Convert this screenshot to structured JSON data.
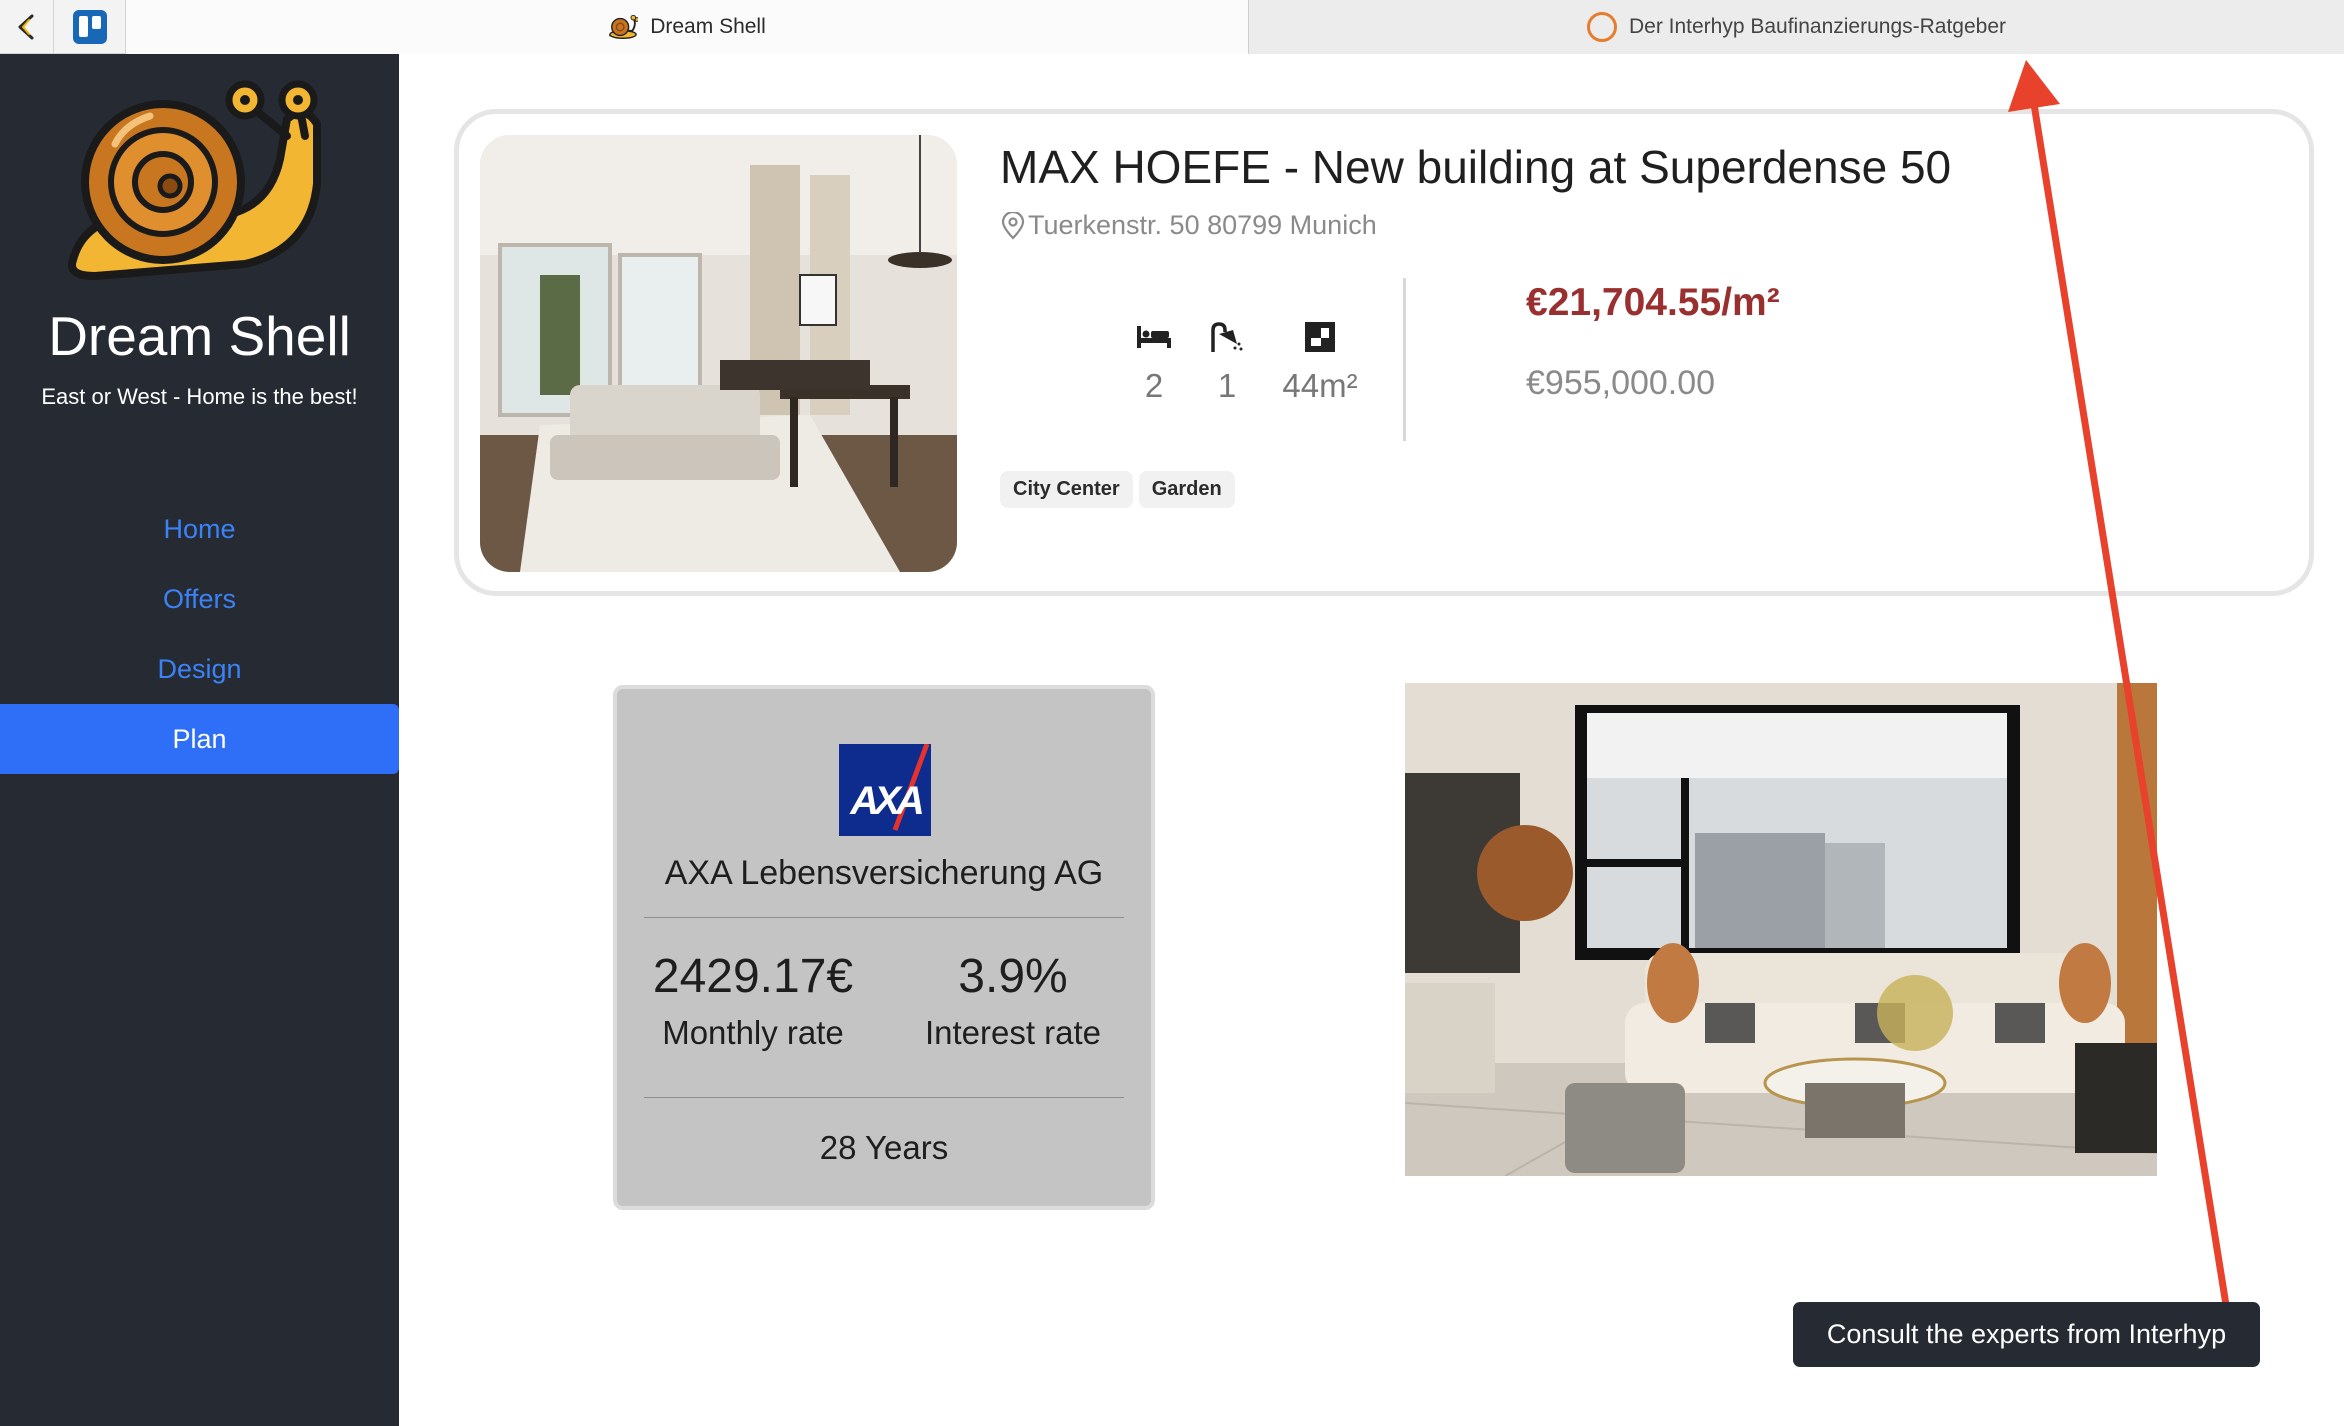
{
  "tabs": [
    {
      "label": "Dream Shell",
      "icon": "snail-icon",
      "active": true
    },
    {
      "label": "Der Interhyp Baufinanzierungs-Ratgeber",
      "icon": "loading-ring-icon",
      "active": false
    }
  ],
  "sidebar": {
    "brand": "Dream Shell",
    "tagline": "East or West - Home is the best!",
    "nav": [
      {
        "label": "Home",
        "active": false
      },
      {
        "label": "Offers",
        "active": false
      },
      {
        "label": "Design",
        "active": false
      },
      {
        "label": "Plan",
        "active": true
      }
    ]
  },
  "listing": {
    "title": "MAX HOEFE - New building at Superdense 50",
    "address": "Tuerkenstr. 50 80799 Munich",
    "bedrooms": "2",
    "bathrooms": "1",
    "area": "44m²",
    "price_per_sqm": "€21,704.55/m²",
    "price": "€955,000.00",
    "tags": [
      "City Center",
      "Garden"
    ]
  },
  "insurance": {
    "logo_text": "AXA",
    "name": "AXA Lebensversicherung AG",
    "monthly_rate_value": "2429.17€",
    "monthly_rate_label": "Monthly rate",
    "interest_rate_value": "3.9%",
    "interest_rate_label": "Interest rate",
    "term": "28 Years"
  },
  "tooltip": {
    "text": "Consult the experts from Interhyp"
  },
  "colors": {
    "sidebar_bg": "#262a33",
    "accent": "#2f6ef6",
    "nav_link": "#3b82f6",
    "price_per_sqm": "#9a2f2f",
    "annotation_arrow": "#e8412c",
    "axa_blue": "#0e2c8e",
    "axa_red": "#e5322d"
  }
}
